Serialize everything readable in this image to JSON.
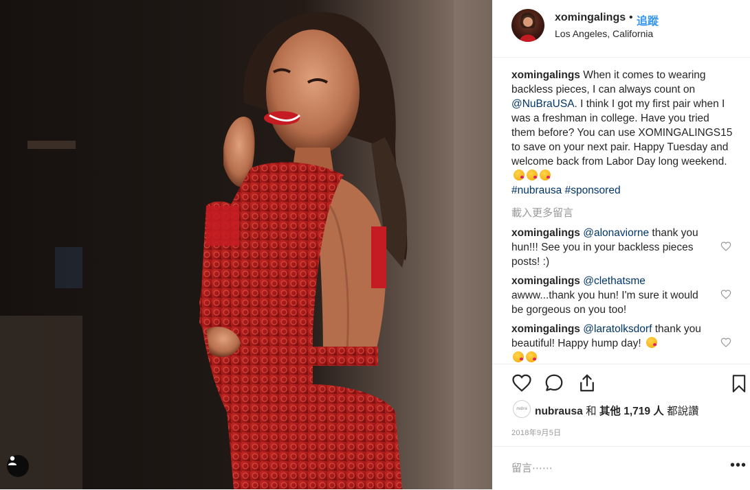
{
  "post": {
    "username": "xomingalings",
    "dot": "•",
    "follow_label": "追蹤",
    "location": "Los Angeles, California"
  },
  "caption": {
    "username": "xomingalings",
    "text_1": " When it comes to wearing backless pieces, I can always count on ",
    "mention": "@NuBraUSA",
    "text_2": ". I think I got my first pair when I was a freshman in college. Have you tried them before? You can use XOMINGALINGS15 to save on your next pair. Happy Tuesday and welcome back from Labor Day long weekend.",
    "hashtag_1": "#nubrausa",
    "hashtag_2": "#sponsored"
  },
  "load_more": "載入更多留言",
  "comments": [
    {
      "username": "xomingalings",
      "mention": "@alonaviorne",
      "text": " thank you hun!!! See you in your backless pieces posts! :)"
    },
    {
      "username": "xomingalings",
      "mention": "@clethatsme",
      "text": " awww...thank you hun! I'm sure it would be gorgeous on you too!"
    },
    {
      "username": "xomingalings",
      "mention": "@laratolksdorf",
      "text": " thank you beautiful! Happy hump day! "
    }
  ],
  "likes": {
    "avatar_text": "nubra",
    "user": "nubrausa",
    "and": " 和 ",
    "others": "其他 1,719 人",
    "suffix": " 都說讚"
  },
  "date": "2018年9月5日",
  "add_comment_placeholder": "留言⋯⋯",
  "more_label": "•••",
  "icons": [
    "heart-icon",
    "comment-icon",
    "share-icon",
    "bookmark-icon",
    "user-tag-icon"
  ],
  "colors": {
    "link": "#3897f0",
    "mention": "#003569",
    "muted": "#999999",
    "dress": "#b01c1c"
  }
}
